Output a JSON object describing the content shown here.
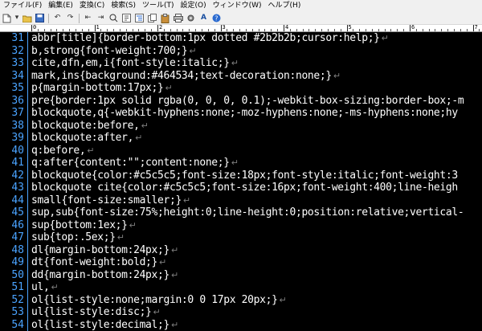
{
  "menu": [
    "ファイル(F)",
    "編集(E)",
    "変換(C)",
    "検索(S)",
    "ツール(T)",
    "設定(O)",
    "ウィンドウ(W)",
    "ヘルプ(H)"
  ],
  "toolbar_icons": [
    "new-file-icon",
    "open-folder-icon",
    "save-icon",
    "undo-icon",
    "redo-icon",
    "search-back-icon",
    "search-forward-icon",
    "grep-icon",
    "jump-icon",
    "outline-icon",
    "copy-icon",
    "paste-icon",
    "print-icon",
    "settings-icon",
    "font-icon",
    "help-icon"
  ],
  "ruler_labels": [
    "0",
    "1",
    "2",
    "3",
    "4",
    "5",
    "6",
    "7"
  ],
  "eol_mark": "↵",
  "lines": [
    {
      "no": "31",
      "text": "abbr[title]{border-bottom:1px dotted #2b2b2b;cursor:help;}",
      "eol": true
    },
    {
      "no": "32",
      "text": "b,strong{font-weight:700;}",
      "eol": true
    },
    {
      "no": "33",
      "text": "cite,dfn,em,i{font-style:italic;}",
      "eol": true
    },
    {
      "no": "34",
      "text": "mark,ins{background:#464534;text-decoration:none;}",
      "eol": true
    },
    {
      "no": "35",
      "text": "p{margin-bottom:17px;}",
      "eol": true
    },
    {
      "no": "36",
      "text": "pre{border:1px solid rgba(0, 0, 0, 0.1);-webkit-box-sizing:border-box;-m",
      "eol": false
    },
    {
      "no": "37",
      "text": "blockquote,q{-webkit-hyphens:none;-moz-hyphens:none;-ms-hyphens:none;hy",
      "eol": false
    },
    {
      "no": "38",
      "text": "blockquote:before,",
      "eol": true
    },
    {
      "no": "39",
      "text": "blockquote:after,",
      "eol": true
    },
    {
      "no": "40",
      "text": "q:before,",
      "eol": true
    },
    {
      "no": "41",
      "text": "q:after{content:\"\";content:none;}",
      "eol": true
    },
    {
      "no": "42",
      "text": "blockquote{color:#c5c5c5;font-size:18px;font-style:italic;font-weight:3",
      "eol": false
    },
    {
      "no": "43",
      "text": "blockquote cite{color:#c5c5c5;font-size:16px;font-weight:400;line-heigh",
      "eol": false
    },
    {
      "no": "44",
      "text": "small{font-size:smaller;}",
      "eol": true
    },
    {
      "no": "45",
      "text": "sup,sub{font-size:75%;height:0;line-height:0;position:relative;vertical-",
      "eol": false
    },
    {
      "no": "46",
      "text": "sup{bottom:1ex;}",
      "eol": true
    },
    {
      "no": "47",
      "text": "sub{top:.5ex;}",
      "eol": true
    },
    {
      "no": "48",
      "text": "dl{margin-bottom:24px;}",
      "eol": true
    },
    {
      "no": "49",
      "text": "dt{font-weight:bold;}",
      "eol": true
    },
    {
      "no": "50",
      "text": "dd{margin-bottom:24px;}",
      "eol": true
    },
    {
      "no": "51",
      "text": "ul,",
      "eol": true
    },
    {
      "no": "52",
      "text": "ol{list-style:none;margin:0 0 17px 20px;}",
      "eol": true
    },
    {
      "no": "53",
      "text": "ul{list-style:disc;}",
      "eol": true
    },
    {
      "no": "54",
      "text": "ol{list-style:decimal;}",
      "eol": true
    }
  ]
}
